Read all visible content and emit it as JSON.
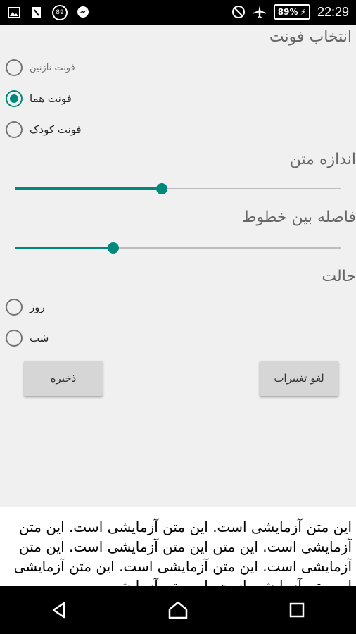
{
  "status_bar": {
    "notification_count": "89",
    "battery": "89%",
    "time": "22:29"
  },
  "font_section": {
    "label": "انتخاب فونت",
    "options": [
      {
        "label": "فونت نازنین",
        "checked": false
      },
      {
        "label": "فونت هما",
        "checked": true
      },
      {
        "label": "فونت کودک",
        "checked": false
      }
    ]
  },
  "text_size": {
    "label": "اندازه متن",
    "value_fraction": 0.45
  },
  "line_spacing": {
    "label": "فاصله بین خطوط",
    "value_fraction": 0.3
  },
  "mode_section": {
    "label": "حالت",
    "options": [
      {
        "label": "روز",
        "checked": false
      },
      {
        "label": "شب",
        "checked": false
      }
    ]
  },
  "buttons": {
    "save": "ذخیره",
    "discard": "لغو تغییرات"
  },
  "preview": {
    "text": "این متن آزمایشی است. این متن آزمایشی است. این متن آزمایشی است. این متن این متن آزمایشی است. این متن آزمایشی است. این متن آزمایشی است. این متن آزمایشی این متن آزمایشی است. این متن آزمایشی"
  },
  "colors": {
    "accent": "#00897b",
    "background": "#f0f0f0"
  }
}
